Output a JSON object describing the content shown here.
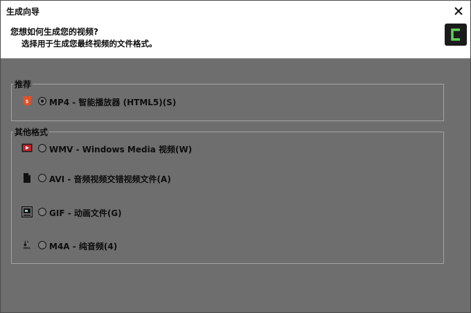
{
  "window": {
    "title": "生成向导"
  },
  "header": {
    "title": "您想如何生成您的视频?",
    "subtitle": "选择用于生成您最终视频的文件格式。"
  },
  "groups": {
    "recommended": {
      "label": "推荐",
      "options": [
        {
          "label": "MP4 - 智能播放器 (HTML5)(S)",
          "icon": "html5-icon",
          "checked": true
        }
      ]
    },
    "other": {
      "label": "其他格式",
      "options": [
        {
          "label": "WMV - Windows Media 视频(W)",
          "icon": "wmv-icon",
          "checked": false
        },
        {
          "label": "AVI - 音频视频交错视频文件(A)",
          "icon": "avi-file-icon",
          "checked": false
        },
        {
          "label": "GIF - 动画文件(G)",
          "icon": "gif-icon",
          "checked": false
        },
        {
          "label": "M4A - 纯音频(4)",
          "icon": "m4a-audio-icon",
          "checked": false
        }
      ]
    }
  },
  "colors": {
    "background": "#6e6e6e",
    "html5_red": "#e34f26",
    "wmv_red": "#c0272d",
    "logo_green": "#5fd35a"
  }
}
